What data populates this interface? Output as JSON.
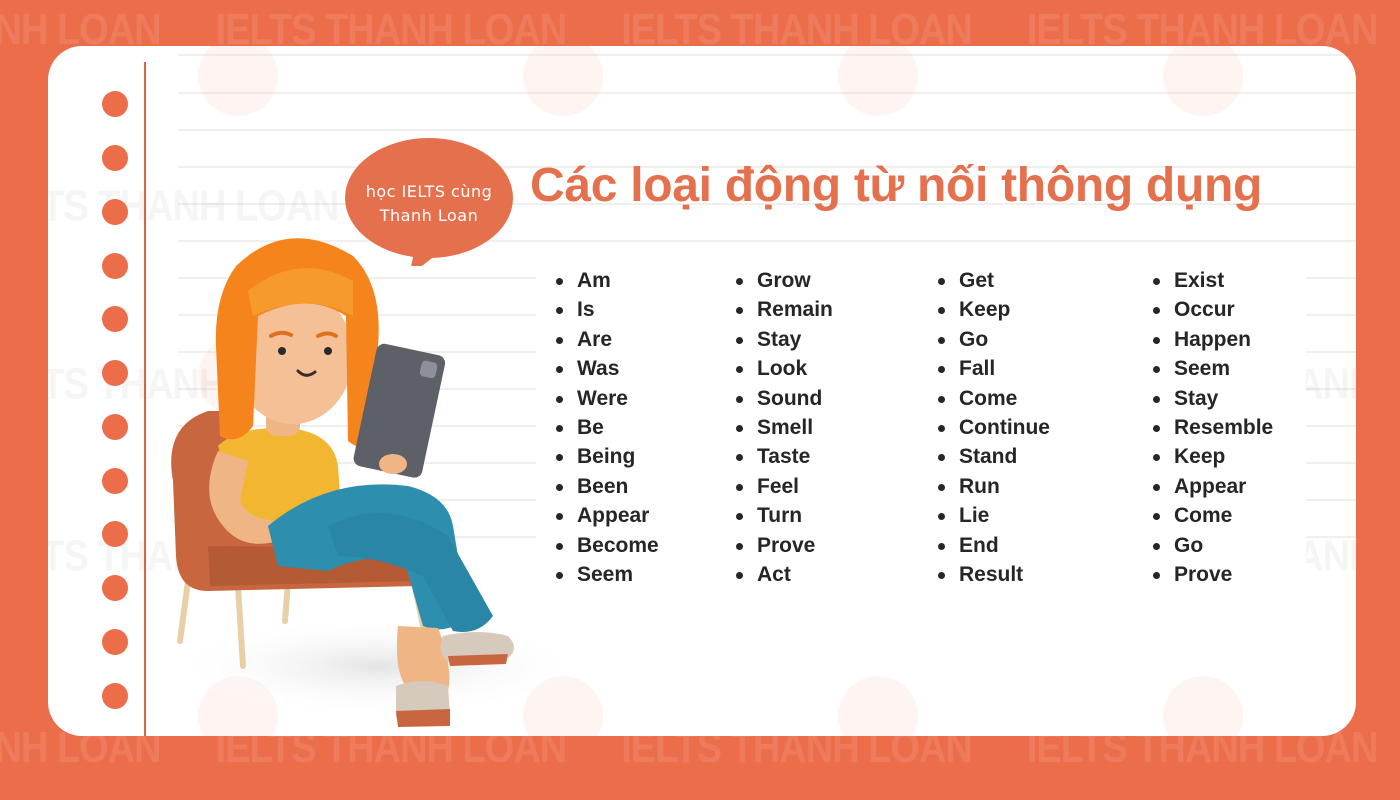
{
  "watermark": "IELTS THANH LOAN",
  "speech_bubble": {
    "line1": "học IELTS cùng",
    "line2": "Thanh Loan"
  },
  "title": "Các loại động từ nối thông dụng",
  "colors": {
    "brand_orange": "#ec6d4a",
    "title_orange": "#e5704d",
    "text_dark": "#262626",
    "card_white": "#ffffff"
  },
  "columns": [
    {
      "items": [
        "Am",
        "Is",
        "Are",
        "Was",
        "Were",
        "Be",
        "Being",
        "Been",
        "Appear",
        "Become",
        "Seem"
      ]
    },
    {
      "items": [
        "Grow",
        "Remain",
        "Stay",
        "Look",
        "Sound",
        "Smell",
        "Taste",
        "Feel",
        "Turn",
        "Prove",
        "Act"
      ]
    },
    {
      "items": [
        "Get",
        "Keep",
        "Go",
        "Fall",
        "Come",
        "Continue",
        "Stand",
        "Run",
        "Lie",
        "End",
        "Result"
      ]
    },
    {
      "items": [
        "Exist",
        "Occur",
        "Happen",
        "Seem",
        "Stay",
        "Resemble",
        "Keep",
        "Appear",
        "Come",
        "Go",
        "Prove"
      ]
    }
  ]
}
